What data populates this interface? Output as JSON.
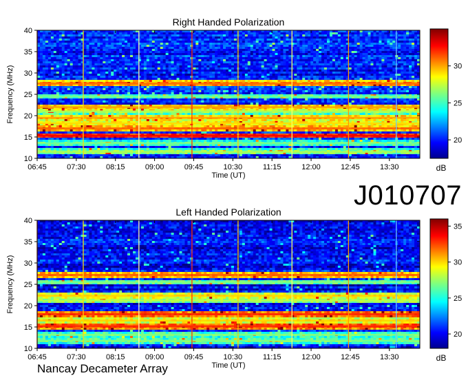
{
  "page": {
    "observation_id": "J010707",
    "footer_label": "Nancay Decameter Array"
  },
  "chart_data": [
    {
      "type": "heatmap",
      "title": "Right Handed Polarization",
      "xlabel": "Time (UT)",
      "ylabel": "Frequency (MHz)",
      "x_ticks": [
        "06:45",
        "07:30",
        "08:15",
        "09:00",
        "09:45",
        "10:30",
        "11:15",
        "12:00",
        "12:45",
        "13:30"
      ],
      "x_range": [
        "06:45",
        "14:05"
      ],
      "y_ticks": [
        10,
        15,
        20,
        25,
        30,
        35,
        40
      ],
      "ylim": [
        10,
        40
      ],
      "colorbar": {
        "label": "dB",
        "ticks": [
          20,
          25,
          30
        ],
        "range": [
          17.5,
          35
        ]
      },
      "emission_bands_mhz": [
        {
          "freq": 27.5,
          "level": 31
        },
        {
          "freq": 24.5,
          "level": 26
        },
        {
          "freq": 22.0,
          "level": 30
        },
        {
          "freq": 21.0,
          "level": 27
        },
        {
          "freq": 19.5,
          "level": 30
        },
        {
          "freq": 18.2,
          "level": 29
        },
        {
          "freq": 17.0,
          "level": 31
        },
        {
          "freq": 15.3,
          "level": 33
        },
        {
          "freq": 13.5,
          "level": 26
        },
        {
          "freq": 11.5,
          "level": 27
        }
      ],
      "vertical_interference_times": [
        "06:45",
        "07:38",
        "08:42",
        "09:43",
        "10:36",
        "11:38",
        "12:43",
        "13:38"
      ]
    },
    {
      "type": "heatmap",
      "title": "Left Handed Polarization",
      "xlabel": "Time (UT)",
      "ylabel": "Frequency (MHz)",
      "x_ticks": [
        "06:45",
        "07:30",
        "08:15",
        "09:00",
        "09:45",
        "10:30",
        "11:15",
        "12:00",
        "12:45",
        "13:30"
      ],
      "x_range": [
        "06:45",
        "14:05"
      ],
      "y_ticks": [
        10,
        15,
        20,
        25,
        30,
        35,
        40
      ],
      "ylim": [
        10,
        40
      ],
      "colorbar": {
        "label": "dB",
        "ticks": [
          20,
          25,
          30,
          35
        ],
        "range": [
          18,
          36
        ]
      },
      "emission_bands_mhz": [
        {
          "freq": 27.2,
          "level": 32
        },
        {
          "freq": 25.5,
          "level": 27
        },
        {
          "freq": 22.3,
          "level": 30
        },
        {
          "freq": 21.2,
          "level": 28
        },
        {
          "freq": 18.0,
          "level": 33
        },
        {
          "freq": 16.5,
          "level": 30
        },
        {
          "freq": 15.2,
          "level": 33
        },
        {
          "freq": 13.2,
          "level": 27
        },
        {
          "freq": 11.8,
          "level": 27
        }
      ],
      "vertical_interference_times": [
        "06:45",
        "07:38",
        "08:42",
        "09:43",
        "10:36",
        "11:38",
        "12:43",
        "13:38"
      ]
    }
  ]
}
